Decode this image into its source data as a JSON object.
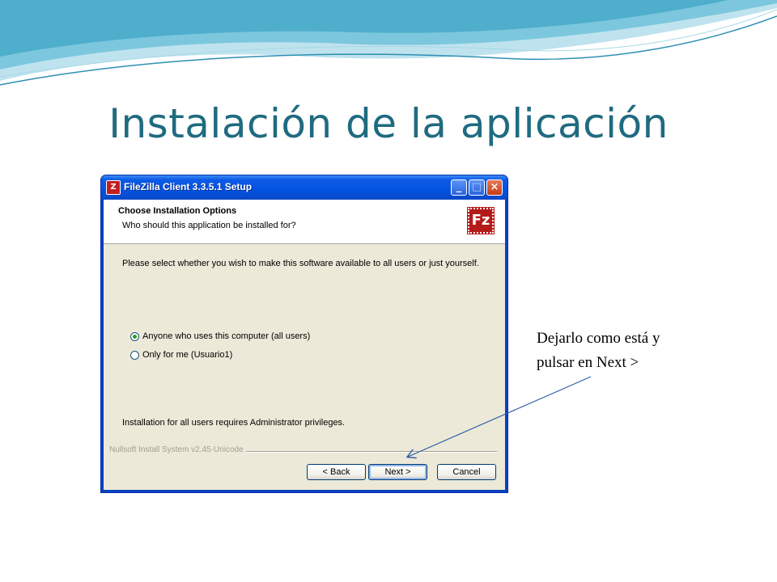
{
  "slide": {
    "title": "Instalación de la aplicación",
    "annotation": {
      "line1": "Dejarlo como está y",
      "line2": "pulsar en Next >"
    }
  },
  "window": {
    "title": "FileZilla Client 3.3.5.1 Setup",
    "icon": "filezilla-icon",
    "controls": {
      "minimize": "minimize-icon",
      "maximize": "maximize-icon",
      "close": "close-icon"
    }
  },
  "header": {
    "title": "Choose Installation Options",
    "subtitle": "Who should this application be installed for?",
    "logo": "filezilla-logo"
  },
  "body": {
    "intro": "Please select whether you wish to make this software available to all users or just yourself.",
    "options": [
      {
        "label": "Anyone who uses this computer (all users)",
        "selected": true
      },
      {
        "label": "Only for me (Usuario1)",
        "selected": false
      }
    ],
    "note": "Installation for all users requires Administrator privileges."
  },
  "footer": {
    "branding": "Nullsoft Install System v2.45-Unicode",
    "back_label": "< Back",
    "next_label": "Next >",
    "cancel_label": "Cancel"
  },
  "colors": {
    "title": "#1f6b80",
    "titlebar": "#0452e2",
    "dialog_bg": "#ece9d8",
    "radio_selected": "#21a121",
    "arrow": "#2e5fa8"
  }
}
